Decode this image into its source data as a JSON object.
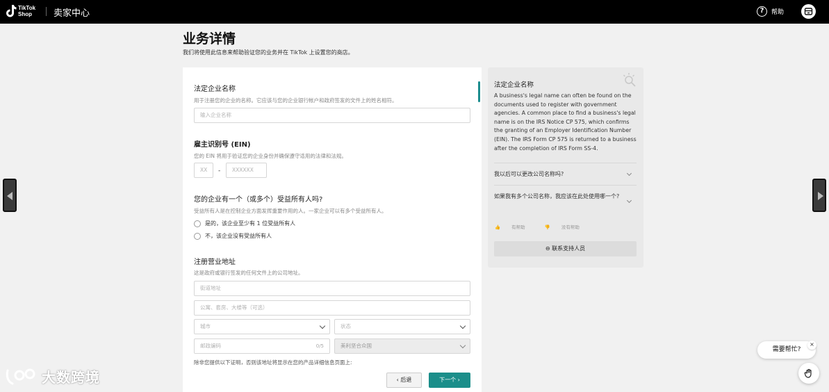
{
  "header": {
    "logo_line1": "TikTok",
    "logo_line2": "Shop",
    "app_title": "卖家中心",
    "help_label": "帮助"
  },
  "page": {
    "title": "业务详情",
    "subtitle": "我们将使用此信息来帮助验证您的业务并在 TikTok 上设置您的商店。"
  },
  "form": {
    "legal_name": {
      "title": "法定企业名称",
      "desc": "用于注册您的企业的名称。它应该与您的企业银行帐户和政府签发的文件上的姓名相符。",
      "placeholder": "输入企业名称"
    },
    "ein": {
      "title": "雇主识别号 (EIN)",
      "desc": "您的 EIN 将用于验证您的企业身份并确保遵守适用的法律和法规。",
      "part1_placeholder": "XX",
      "separator": "-",
      "part2_placeholder": "XXXXXX"
    },
    "beneficial_owner": {
      "title": "您的企业有一个（或多个）受益所有人吗?",
      "desc": "受益所有人是在控制企业方面发挥重要作用的人。一家企业可以有多个受益所有人。",
      "options": [
        "是的，该企业至少有 1 位受益所有人",
        "不，该企业没有受益所有人"
      ]
    },
    "address": {
      "title": "注册营业地址",
      "desc": "这是政府或银行签发的任何文件上的公司地址。",
      "street_placeholder": "街道地址",
      "apt_placeholder": "公寓、套房、大楼等（可选）",
      "city_placeholder": "城市",
      "state_placeholder": "状态",
      "zip_placeholder": "邮政编码",
      "zip_counter": "0/5",
      "country_value": "美利坚合众国",
      "note": "除非您提供以下证明，否则该地址将显示在您的产品详细信息页面上:"
    },
    "back_label": "后退",
    "next_label": "下一个"
  },
  "help_panel": {
    "title": "法定企业名称",
    "body": "A business's legal name can often be found on the documents used to register with government agencies. A common place to find a business's legal name is on the IRS Notice CP 575, which confirms the granting of an Employer Identification Number (EIN). The IRS Form CP 575 is returned to a business after the completion of IRS Form SS-4.",
    "faq": [
      "我以后可以更改公司名称吗?",
      "如果我有多个公司名称，我应该在此处使用哪一个?"
    ],
    "helpful_label": "有帮助",
    "not_helpful_label": "没有帮助",
    "contact_label": "联系支持人员"
  },
  "widget": {
    "need_help": "需要帮忙?",
    "close_symbol": "×"
  },
  "watermark": {
    "text": "大数跨境"
  },
  "colors": {
    "accent": "#1b8e8a",
    "topbar": "#000000",
    "background": "#f1f1f1"
  }
}
